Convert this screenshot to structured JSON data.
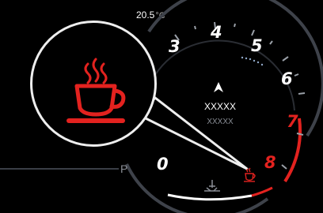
{
  "temperature": {
    "value": "20.5",
    "unit": "°C"
  },
  "gauge": {
    "numbers": [
      "3",
      "4",
      "5",
      "6",
      "7",
      "8",
      "0"
    ],
    "red_numbers": [
      "7",
      "8"
    ]
  },
  "navigation": {
    "primary": "XXXXX",
    "secondary": "XXXXX",
    "icon": "navigation-arrow-icon"
  },
  "gear": "P",
  "warning": {
    "icon": "coffee-cup-icon",
    "meaning": "driver-rest-warning",
    "color": "#e3221f"
  },
  "indicators": [
    "oil-level-icon",
    "coffee-cup-icon"
  ],
  "colors": {
    "accent_red": "#e3221f",
    "gauge_gray": "#5a5f68",
    "text": "#ffffff"
  }
}
